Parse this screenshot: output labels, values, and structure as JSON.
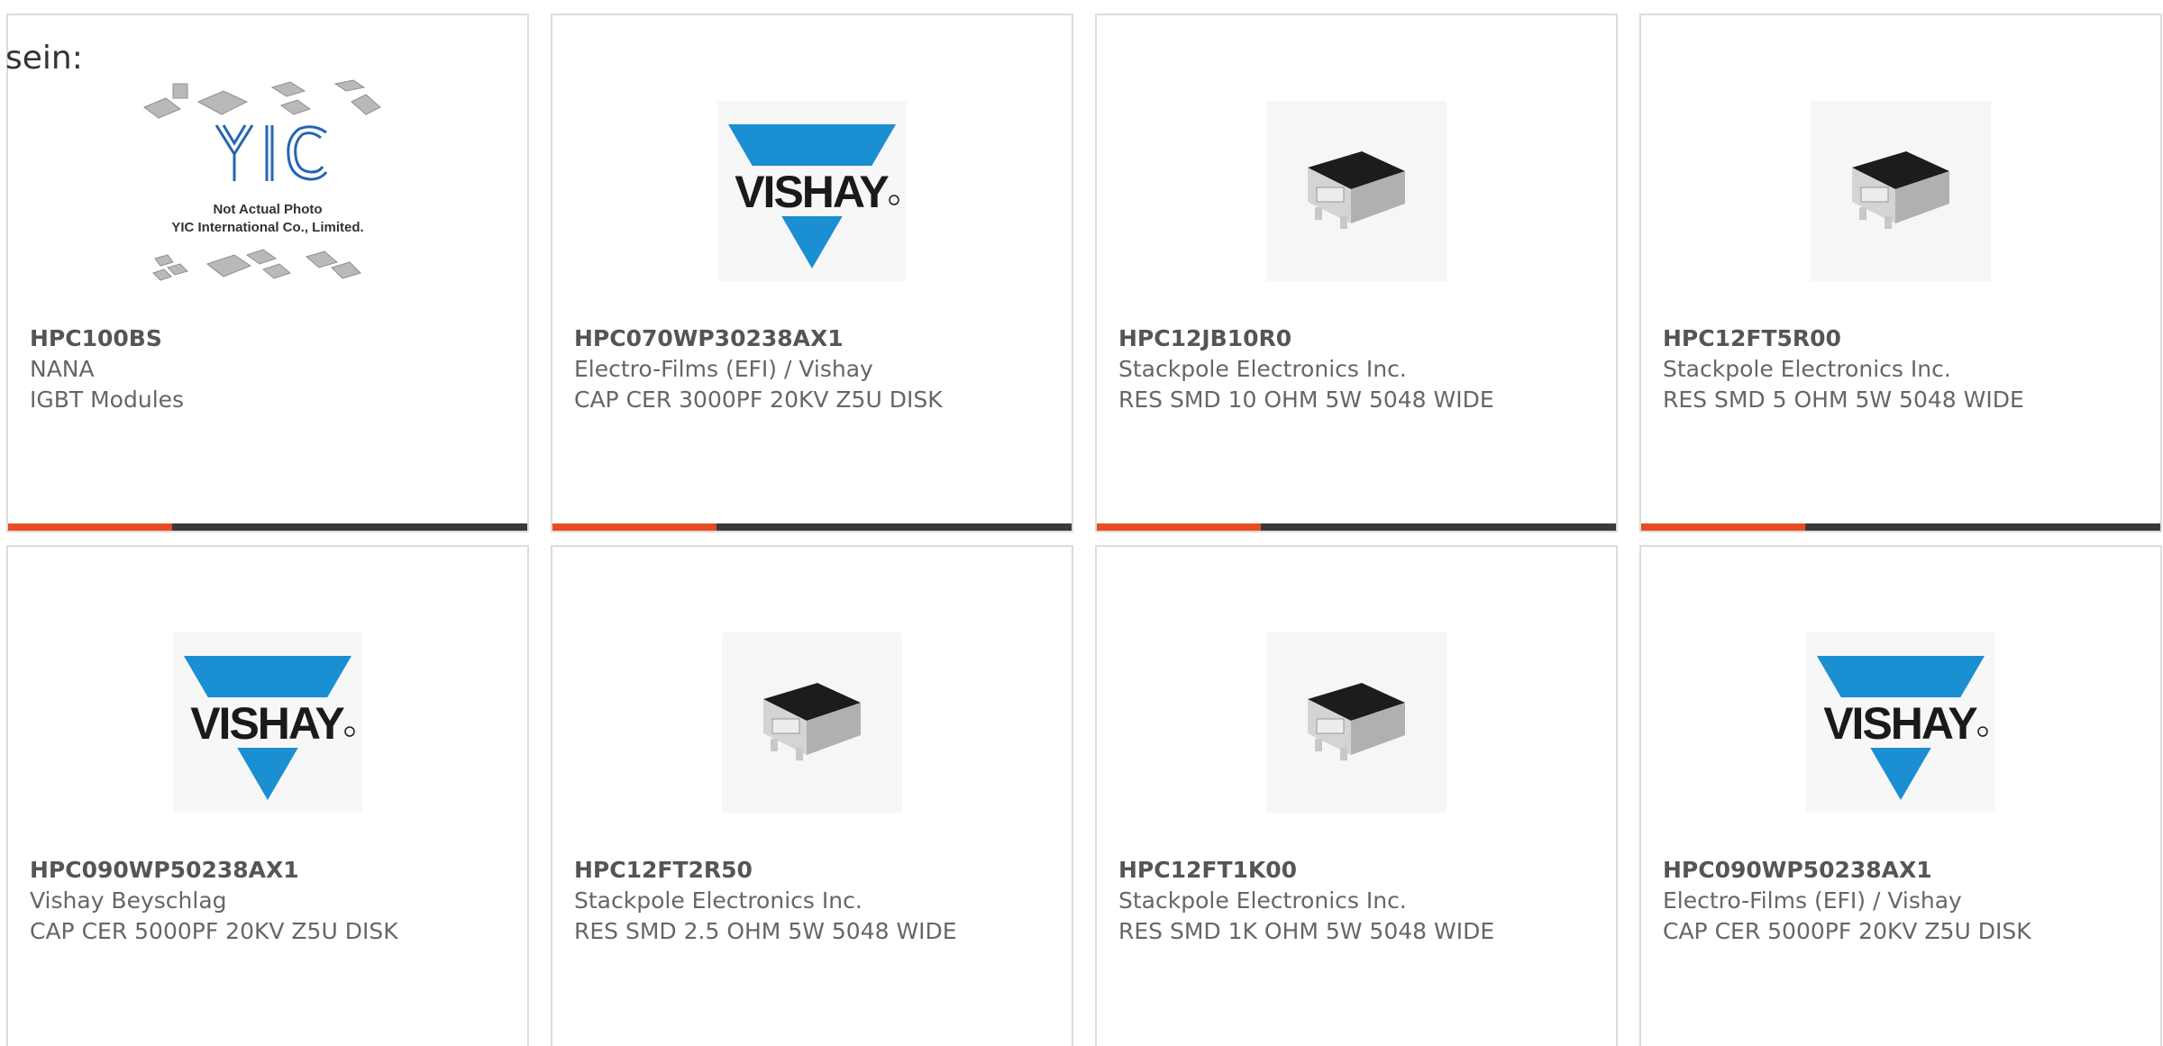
{
  "page": {
    "heading": "sein:"
  },
  "colors": {
    "accent": "#e84c22",
    "bar": "#3a3a3a",
    "vishay_blue": "#1a8fd1",
    "border": "#dcdcdc"
  },
  "cards": [
    {
      "part": "HPC100BS",
      "maker": "NANA",
      "desc": "IGBT Modules",
      "image": "yic-placeholder",
      "image_text_1": "Not Actual Photo",
      "image_text_2": "YIC International Co., Limited.",
      "image_logo": "YIC"
    },
    {
      "part": "HPC070WP30238AX1",
      "maker": "Electro-Films (EFI) / Vishay",
      "desc": "CAP CER 3000PF 20KV Z5U DISK",
      "image": "vishay-logo",
      "logo_text": "VISHAY"
    },
    {
      "part": "HPC12JB10R0",
      "maker": "Stackpole Electronics Inc.",
      "desc": "RES SMD 10 OHM 5W 5048 WIDE",
      "image": "resistor-photo"
    },
    {
      "part": "HPC12FT5R00",
      "maker": "Stackpole Electronics Inc.",
      "desc": "RES SMD 5 OHM 5W 5048 WIDE",
      "image": "resistor-photo"
    },
    {
      "part": "HPC090WP50238AX1",
      "maker": "Vishay Beyschlag",
      "desc": "CAP CER 5000PF 20KV Z5U DISK",
      "image": "vishay-logo",
      "logo_text": "VISHAY"
    },
    {
      "part": "HPC12FT2R50",
      "maker": "Stackpole Electronics Inc.",
      "desc": "RES SMD 2.5 OHM 5W 5048 WIDE",
      "image": "resistor-photo"
    },
    {
      "part": "HPC12FT1K00",
      "maker": "Stackpole Electronics Inc.",
      "desc": "RES SMD 1K OHM 5W 5048 WIDE",
      "image": "resistor-photo"
    },
    {
      "part": "HPC090WP50238AX1",
      "maker": "Electro-Films (EFI) / Vishay",
      "desc": "CAP CER 5000PF 20KV Z5U DISK",
      "image": "vishay-logo",
      "logo_text": "VISHAY"
    }
  ]
}
